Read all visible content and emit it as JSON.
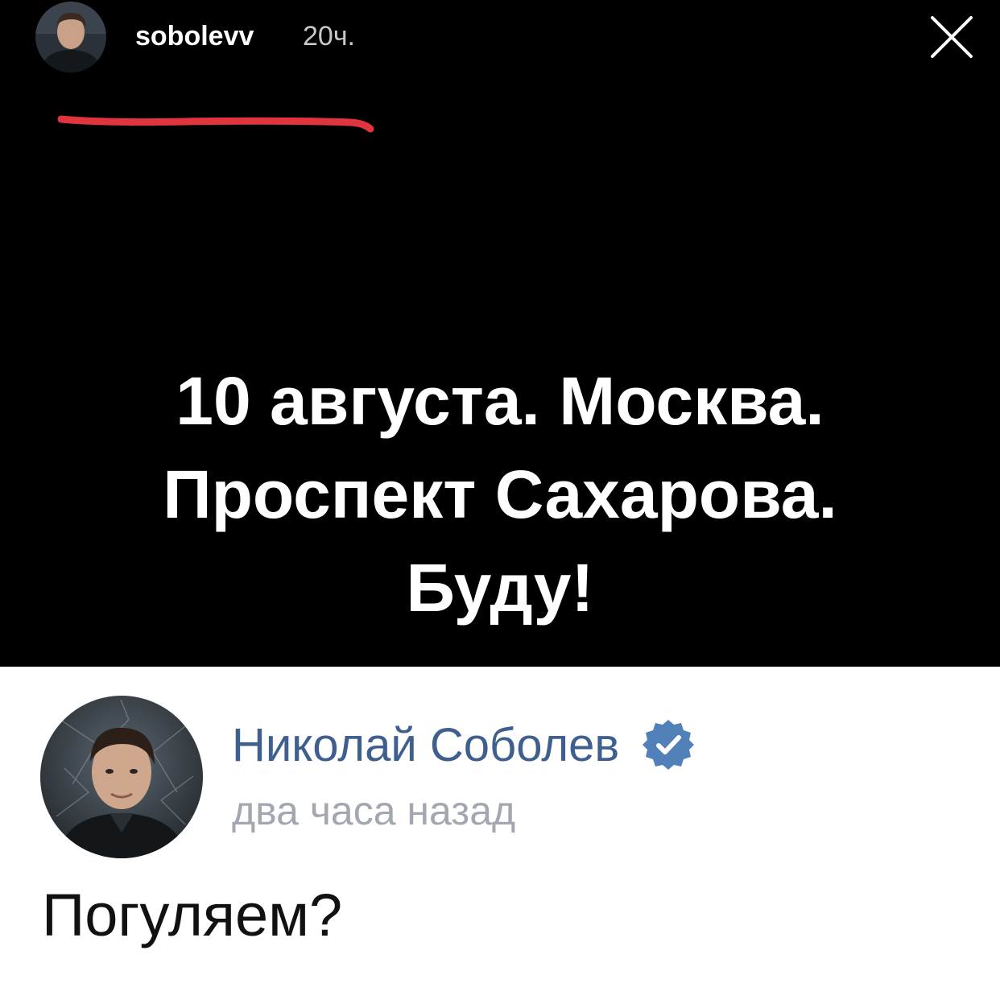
{
  "story": {
    "username": "sobolevv",
    "time": "20ч.",
    "close_icon": "close-icon",
    "underline_color": "#e0353f",
    "lines": [
      "10 августа. Москва.",
      "Проспект Сахарова.",
      "Буду!"
    ]
  },
  "comment": {
    "author": "Николай Соболев",
    "verified_icon": "verified-badge-icon",
    "verified_color": "#5181b8",
    "time": "два часа назад",
    "text": "Погуляем?"
  }
}
